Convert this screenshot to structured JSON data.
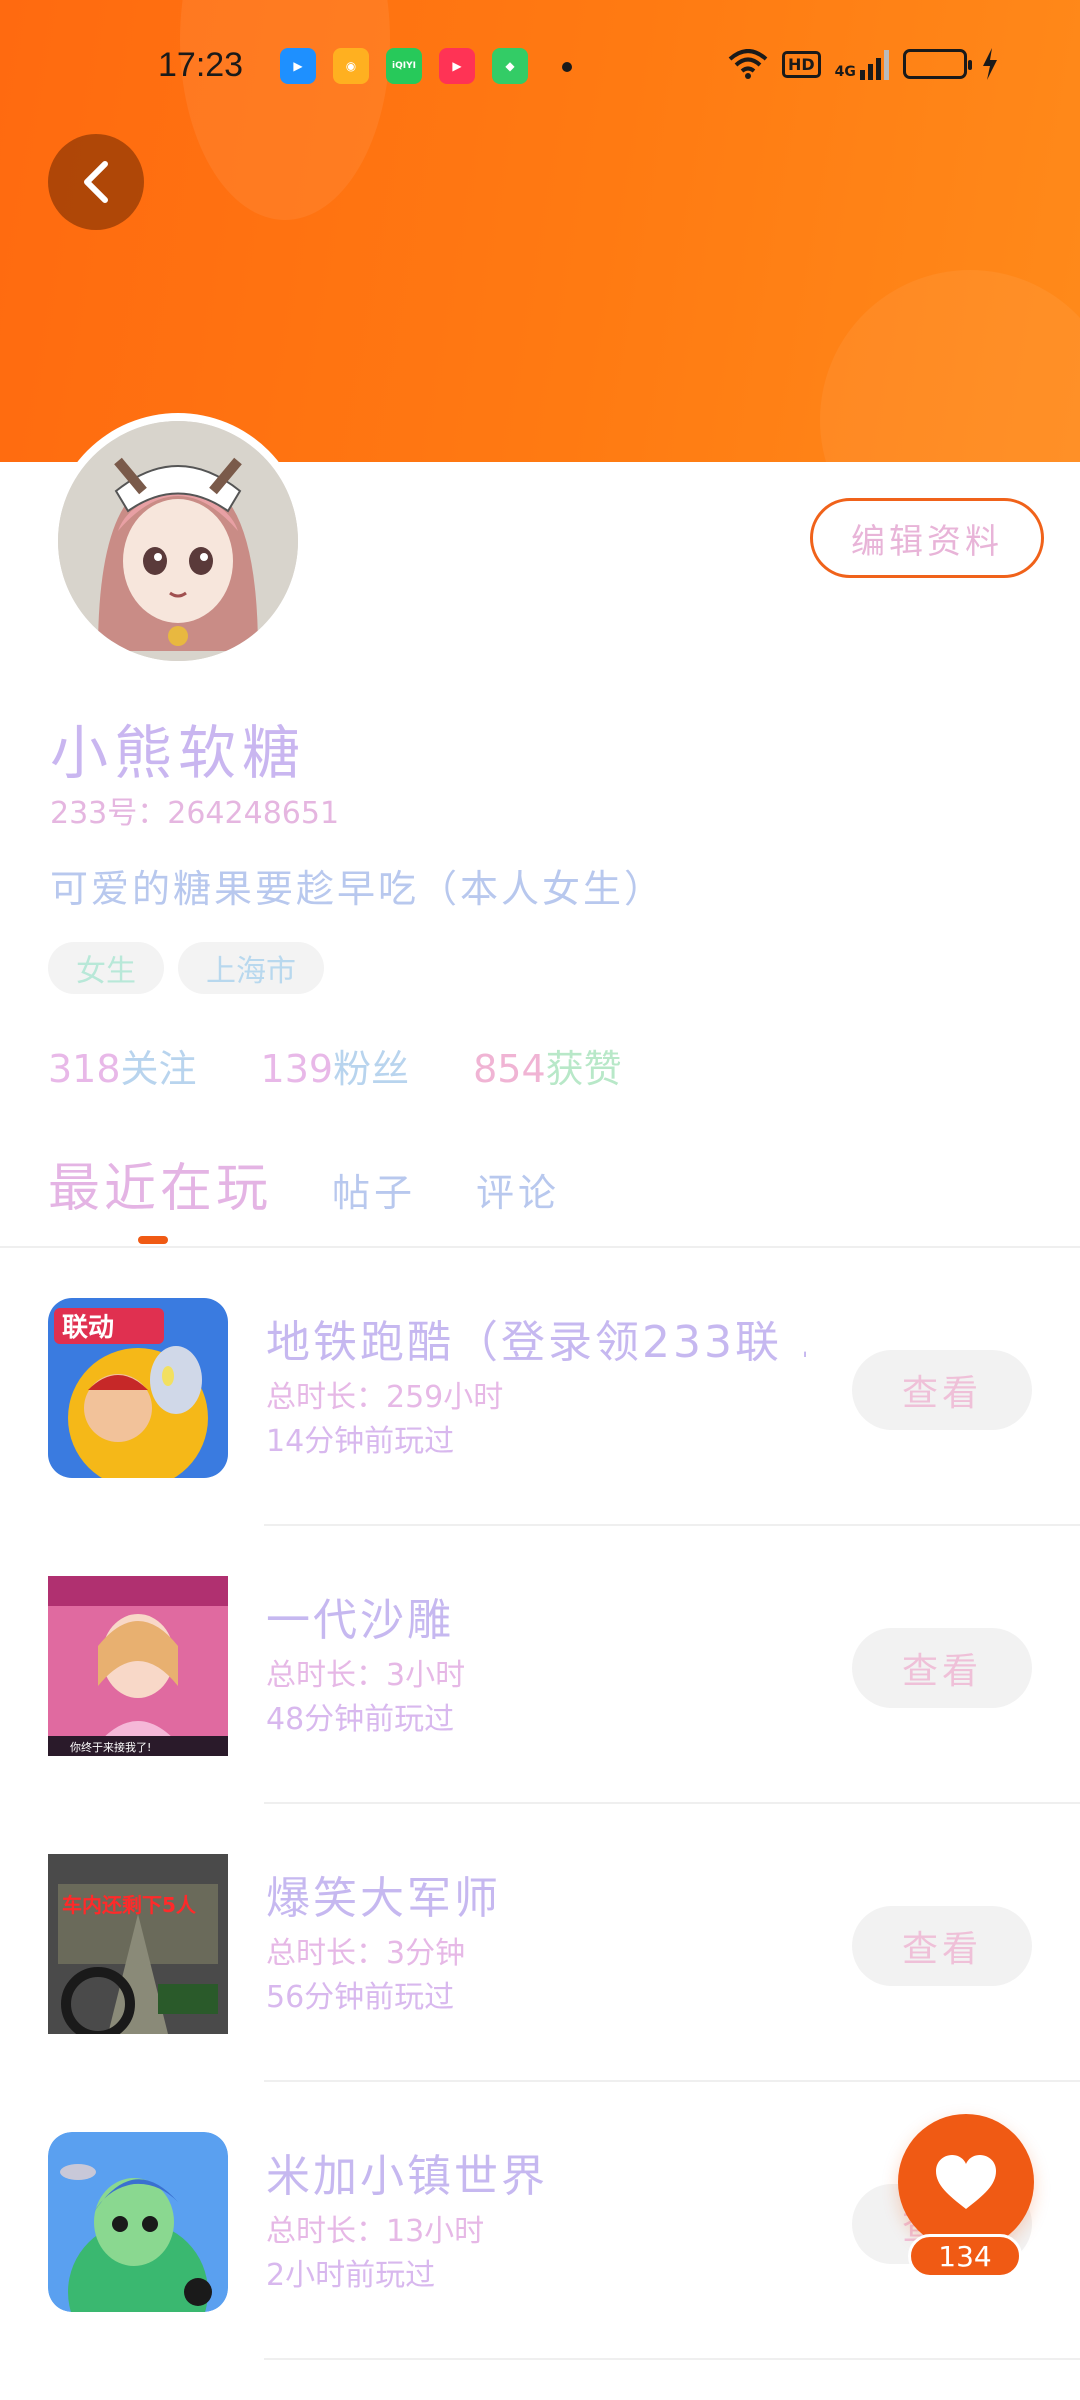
{
  "status_bar": {
    "time": "17:23",
    "network": "4G"
  },
  "header": {
    "back_icon": "chevron-left-icon"
  },
  "profile": {
    "edit_label": "编辑资料",
    "nickname": "小熊软糖",
    "uid": "233号：264248651",
    "bio": "可爱的糖果要趁早吃（本人女生）",
    "tags": [
      "女生",
      "上海市"
    ],
    "stats": [
      {
        "num": "318",
        "label": "关注"
      },
      {
        "num": "139",
        "label": "粉丝"
      },
      {
        "num": "854",
        "label": "获赞"
      }
    ]
  },
  "tabs": [
    {
      "label": "最近在玩",
      "active": true
    },
    {
      "label": "帖子",
      "active": false
    },
    {
      "label": "评论",
      "active": false
    }
  ],
  "games": [
    {
      "title": "地铁跑酷（登录领233联 …",
      "duration": "总时长：259小时",
      "last_played": "14分钟前玩过",
      "button": "查看",
      "icon_text": "联动"
    },
    {
      "title": "一代沙雕",
      "duration": "总时长：3小时",
      "last_played": "48分钟前玩过",
      "button": "查看",
      "icon_text": "你终于来接我了!"
    },
    {
      "title": "爆笑大军师",
      "duration": "总时长：3分钟",
      "last_played": "56分钟前玩过",
      "button": "查看",
      "icon_text": "车内还剩下5人"
    },
    {
      "title": "米加小镇世界",
      "duration": "总时长：13小时",
      "last_played": "2小时前玩过",
      "button": "查看",
      "icon_text": ""
    }
  ],
  "like_fab": {
    "count": "134",
    "icon": "heart-icon"
  },
  "colors": {
    "accent": "#f05a14",
    "header_start": "#ff6a10",
    "header_end": "#ff8a1a"
  }
}
